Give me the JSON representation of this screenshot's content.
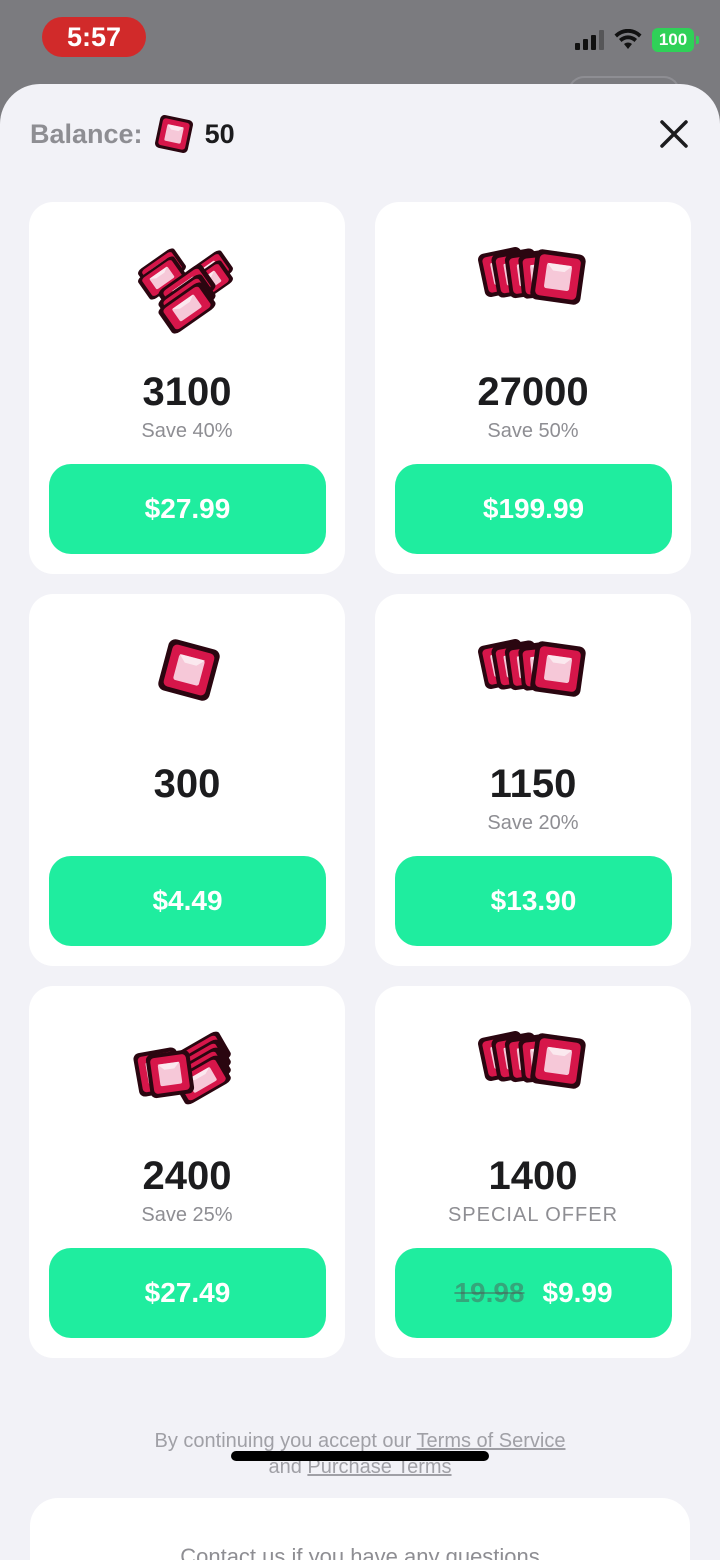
{
  "status_bar": {
    "time": "5:57",
    "battery": "100"
  },
  "header": {
    "balance_label": "Balance:",
    "balance_value": "50",
    "close_icon": "close-icon"
  },
  "packs": [
    {
      "amount": "3100",
      "save": "Save 40%",
      "price": "$27.99",
      "icon": "gem-pile-icon"
    },
    {
      "amount": "27000",
      "save": "Save 50%",
      "price": "$199.99",
      "icon": "gem-fan-icon"
    },
    {
      "amount": "300",
      "save": "",
      "price": "$4.49",
      "icon": "single-gem-icon"
    },
    {
      "amount": "1150",
      "save": "Save 20%",
      "price": "$13.90",
      "icon": "gem-fan-icon"
    },
    {
      "amount": "2400",
      "save": "Save 25%",
      "price": "$27.49",
      "icon": "gem-stack-icon"
    },
    {
      "amount": "1400",
      "save": "SPECIAL OFFER",
      "price": "$9.99",
      "old_price": "19.98",
      "icon": "gem-fan-icon"
    }
  ],
  "terms": {
    "prefix": "By continuing you accept our",
    "tos_link": "Terms of Service",
    "and": "and",
    "purchase_link": "Purchase Terms"
  },
  "contact": {
    "text": "Contact us if you have any questions"
  },
  "colors": {
    "accent": "#1fed9f",
    "gem": "#d6164a",
    "background": "#f2f2f7"
  }
}
